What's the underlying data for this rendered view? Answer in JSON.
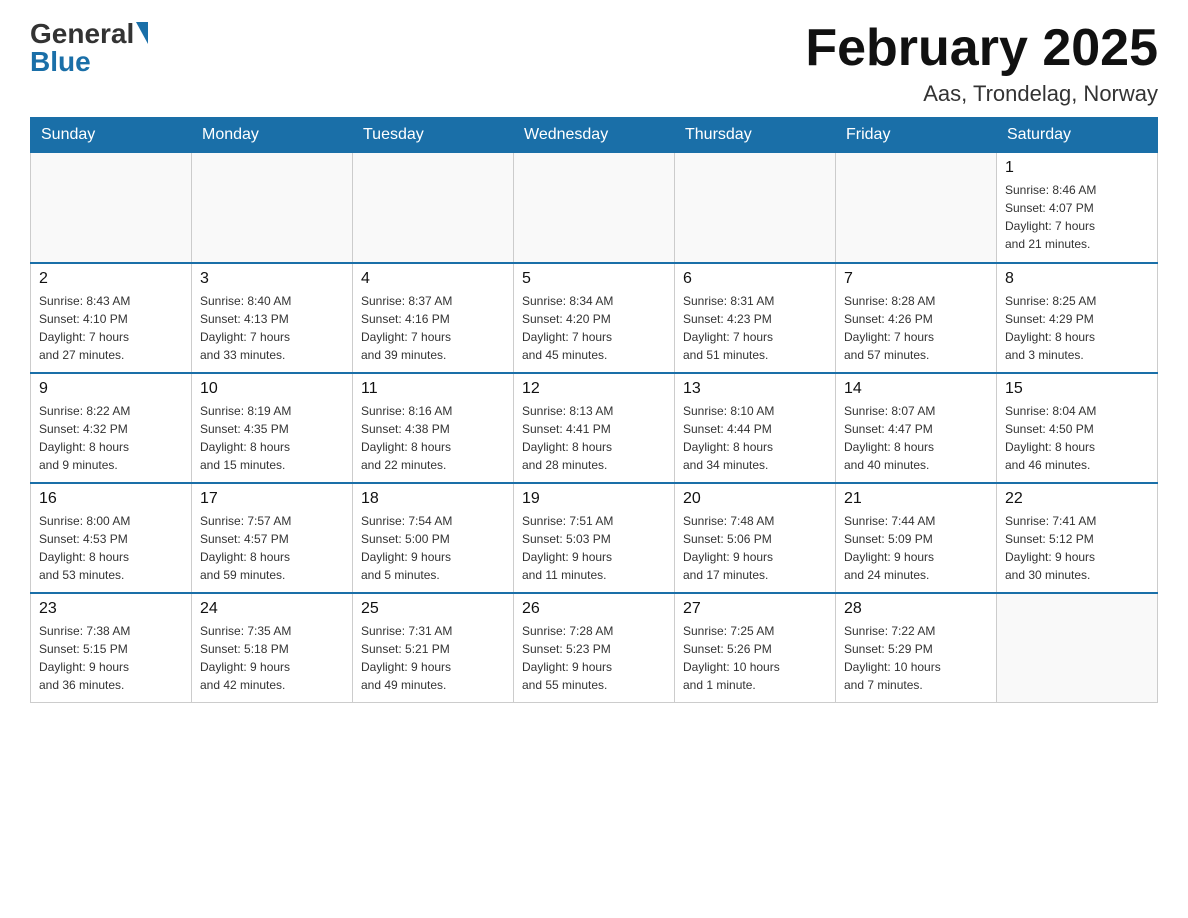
{
  "header": {
    "logo_general": "General",
    "logo_blue": "Blue",
    "title": "February 2025",
    "subtitle": "Aas, Trondelag, Norway"
  },
  "days_of_week": [
    "Sunday",
    "Monday",
    "Tuesday",
    "Wednesday",
    "Thursday",
    "Friday",
    "Saturday"
  ],
  "weeks": [
    [
      {
        "day": "",
        "info": []
      },
      {
        "day": "",
        "info": []
      },
      {
        "day": "",
        "info": []
      },
      {
        "day": "",
        "info": []
      },
      {
        "day": "",
        "info": []
      },
      {
        "day": "",
        "info": []
      },
      {
        "day": "1",
        "info": [
          "Sunrise: 8:46 AM",
          "Sunset: 4:07 PM",
          "Daylight: 7 hours",
          "and 21 minutes."
        ]
      }
    ],
    [
      {
        "day": "2",
        "info": [
          "Sunrise: 8:43 AM",
          "Sunset: 4:10 PM",
          "Daylight: 7 hours",
          "and 27 minutes."
        ]
      },
      {
        "day": "3",
        "info": [
          "Sunrise: 8:40 AM",
          "Sunset: 4:13 PM",
          "Daylight: 7 hours",
          "and 33 minutes."
        ]
      },
      {
        "day": "4",
        "info": [
          "Sunrise: 8:37 AM",
          "Sunset: 4:16 PM",
          "Daylight: 7 hours",
          "and 39 minutes."
        ]
      },
      {
        "day": "5",
        "info": [
          "Sunrise: 8:34 AM",
          "Sunset: 4:20 PM",
          "Daylight: 7 hours",
          "and 45 minutes."
        ]
      },
      {
        "day": "6",
        "info": [
          "Sunrise: 8:31 AM",
          "Sunset: 4:23 PM",
          "Daylight: 7 hours",
          "and 51 minutes."
        ]
      },
      {
        "day": "7",
        "info": [
          "Sunrise: 8:28 AM",
          "Sunset: 4:26 PM",
          "Daylight: 7 hours",
          "and 57 minutes."
        ]
      },
      {
        "day": "8",
        "info": [
          "Sunrise: 8:25 AM",
          "Sunset: 4:29 PM",
          "Daylight: 8 hours",
          "and 3 minutes."
        ]
      }
    ],
    [
      {
        "day": "9",
        "info": [
          "Sunrise: 8:22 AM",
          "Sunset: 4:32 PM",
          "Daylight: 8 hours",
          "and 9 minutes."
        ]
      },
      {
        "day": "10",
        "info": [
          "Sunrise: 8:19 AM",
          "Sunset: 4:35 PM",
          "Daylight: 8 hours",
          "and 15 minutes."
        ]
      },
      {
        "day": "11",
        "info": [
          "Sunrise: 8:16 AM",
          "Sunset: 4:38 PM",
          "Daylight: 8 hours",
          "and 22 minutes."
        ]
      },
      {
        "day": "12",
        "info": [
          "Sunrise: 8:13 AM",
          "Sunset: 4:41 PM",
          "Daylight: 8 hours",
          "and 28 minutes."
        ]
      },
      {
        "day": "13",
        "info": [
          "Sunrise: 8:10 AM",
          "Sunset: 4:44 PM",
          "Daylight: 8 hours",
          "and 34 minutes."
        ]
      },
      {
        "day": "14",
        "info": [
          "Sunrise: 8:07 AM",
          "Sunset: 4:47 PM",
          "Daylight: 8 hours",
          "and 40 minutes."
        ]
      },
      {
        "day": "15",
        "info": [
          "Sunrise: 8:04 AM",
          "Sunset: 4:50 PM",
          "Daylight: 8 hours",
          "and 46 minutes."
        ]
      }
    ],
    [
      {
        "day": "16",
        "info": [
          "Sunrise: 8:00 AM",
          "Sunset: 4:53 PM",
          "Daylight: 8 hours",
          "and 53 minutes."
        ]
      },
      {
        "day": "17",
        "info": [
          "Sunrise: 7:57 AM",
          "Sunset: 4:57 PM",
          "Daylight: 8 hours",
          "and 59 minutes."
        ]
      },
      {
        "day": "18",
        "info": [
          "Sunrise: 7:54 AM",
          "Sunset: 5:00 PM",
          "Daylight: 9 hours",
          "and 5 minutes."
        ]
      },
      {
        "day": "19",
        "info": [
          "Sunrise: 7:51 AM",
          "Sunset: 5:03 PM",
          "Daylight: 9 hours",
          "and 11 minutes."
        ]
      },
      {
        "day": "20",
        "info": [
          "Sunrise: 7:48 AM",
          "Sunset: 5:06 PM",
          "Daylight: 9 hours",
          "and 17 minutes."
        ]
      },
      {
        "day": "21",
        "info": [
          "Sunrise: 7:44 AM",
          "Sunset: 5:09 PM",
          "Daylight: 9 hours",
          "and 24 minutes."
        ]
      },
      {
        "day": "22",
        "info": [
          "Sunrise: 7:41 AM",
          "Sunset: 5:12 PM",
          "Daylight: 9 hours",
          "and 30 minutes."
        ]
      }
    ],
    [
      {
        "day": "23",
        "info": [
          "Sunrise: 7:38 AM",
          "Sunset: 5:15 PM",
          "Daylight: 9 hours",
          "and 36 minutes."
        ]
      },
      {
        "day": "24",
        "info": [
          "Sunrise: 7:35 AM",
          "Sunset: 5:18 PM",
          "Daylight: 9 hours",
          "and 42 minutes."
        ]
      },
      {
        "day": "25",
        "info": [
          "Sunrise: 7:31 AM",
          "Sunset: 5:21 PM",
          "Daylight: 9 hours",
          "and 49 minutes."
        ]
      },
      {
        "day": "26",
        "info": [
          "Sunrise: 7:28 AM",
          "Sunset: 5:23 PM",
          "Daylight: 9 hours",
          "and 55 minutes."
        ]
      },
      {
        "day": "27",
        "info": [
          "Sunrise: 7:25 AM",
          "Sunset: 5:26 PM",
          "Daylight: 10 hours",
          "and 1 minute."
        ]
      },
      {
        "day": "28",
        "info": [
          "Sunrise: 7:22 AM",
          "Sunset: 5:29 PM",
          "Daylight: 10 hours",
          "and 7 minutes."
        ]
      },
      {
        "day": "",
        "info": []
      }
    ]
  ]
}
